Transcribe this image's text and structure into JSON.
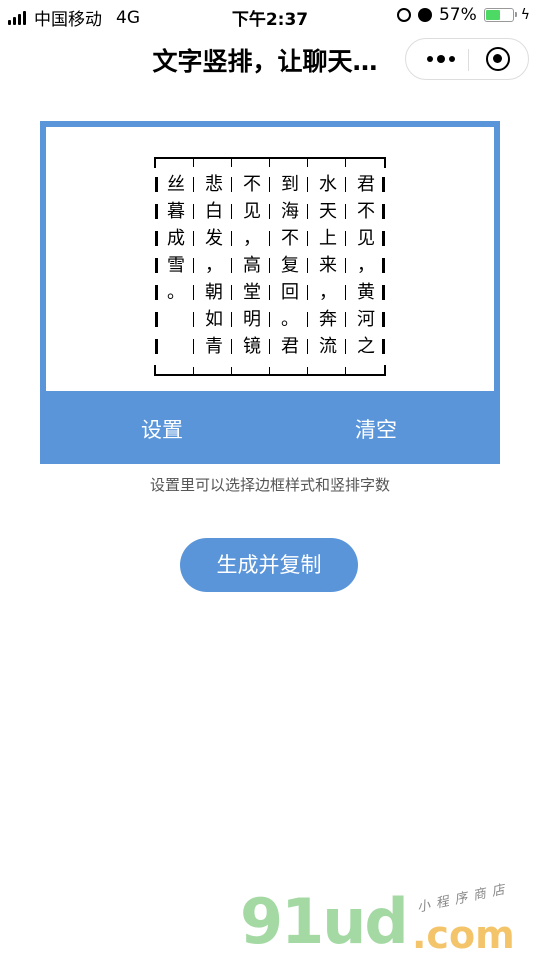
{
  "status_bar": {
    "carrier": "中国移动",
    "network": "4G",
    "time": "下午2:37",
    "battery_percent": "57%",
    "battery_level": 0.57
  },
  "nav": {
    "title": "文字竖排，让聊天…",
    "more_icon": "more-dots-icon",
    "close_icon": "target-circle-icon"
  },
  "editor": {
    "columns": [
      [
        "丝",
        "暮",
        "成",
        "雪",
        "。",
        "",
        ""
      ],
      [
        "悲",
        "白",
        "发",
        "，",
        "朝",
        "如",
        "青"
      ],
      [
        "不",
        "见",
        "，",
        "高",
        "堂",
        "明",
        "镜"
      ],
      [
        "到",
        "海",
        "不",
        "复",
        "回",
        "。",
        "君"
      ],
      [
        "水",
        "天",
        "上",
        "来",
        "，",
        "奔",
        "流"
      ],
      [
        "君",
        "不",
        "见",
        "，",
        "黄",
        "河",
        "之"
      ]
    ],
    "settings_label": "设置",
    "clear_label": "清空"
  },
  "hint": "设置里可以选择边框样式和竖排字数",
  "generate_label": "生成并复制",
  "watermark": {
    "main": "91ud",
    "suffix": ".com",
    "tag": "小程序商店"
  },
  "colors": {
    "accent": "#5a95da",
    "battery": "#4cd964"
  }
}
